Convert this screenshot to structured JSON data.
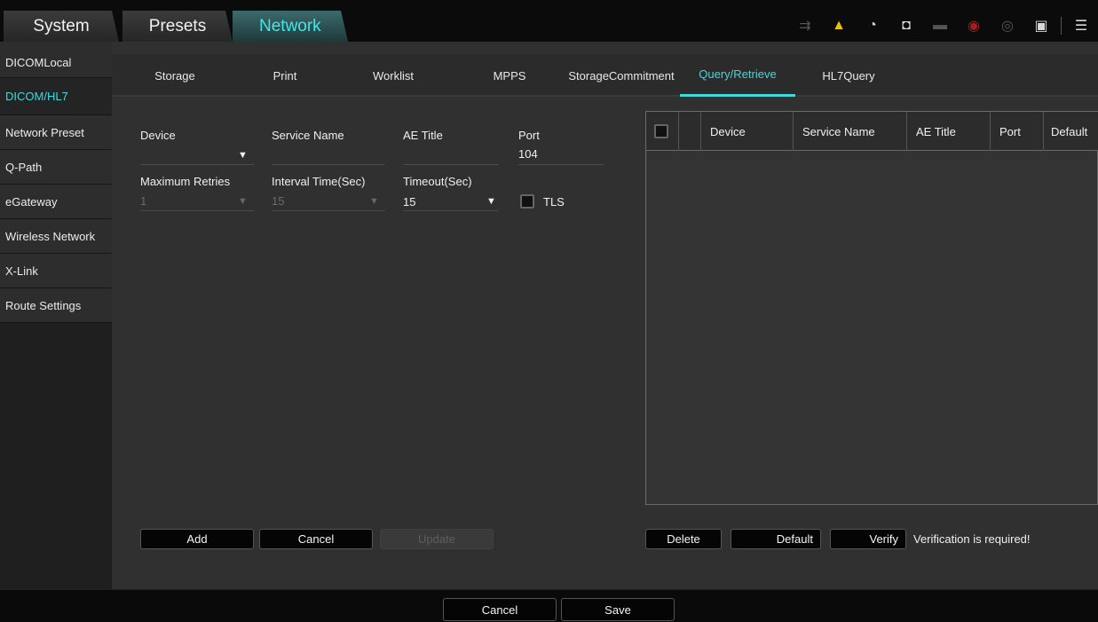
{
  "top_tabs": [
    {
      "label": "System"
    },
    {
      "label": "Presets"
    },
    {
      "label": "Network"
    }
  ],
  "top_icons": [
    "ime-icon",
    "warning-icon",
    "refresh-icon",
    "mouse-icon",
    "usb-icon",
    "network-icon",
    "disc-icon",
    "printer-icon",
    "menu-icon"
  ],
  "sidebar": {
    "items": [
      {
        "label": "DICOMLocal"
      },
      {
        "label": "DICOM/HL7"
      },
      {
        "label": "Network Preset"
      },
      {
        "label": "Q-Path"
      },
      {
        "label": "eGateway"
      },
      {
        "label": "Wireless Network"
      },
      {
        "label": "X-Link"
      },
      {
        "label": "Route Settings"
      }
    ],
    "active": "DICOM/HL7"
  },
  "sub_tabs": [
    {
      "label": "Storage"
    },
    {
      "label": "Print"
    },
    {
      "label": "Worklist"
    },
    {
      "label": "MPPS"
    },
    {
      "label": "StorageCommitment"
    },
    {
      "label": "Query/Retrieve"
    },
    {
      "label": "HL7Query"
    }
  ],
  "active_sub_tab": "Query/Retrieve",
  "form": {
    "device_label": "Device",
    "device_value": "",
    "service_name_label": "Service Name",
    "service_name_value": "",
    "ae_title_label": "AE Title",
    "ae_title_value": "",
    "port_label": "Port",
    "port_value": "104",
    "max_retries_label": "Maximum Retries",
    "max_retries_value": "1",
    "interval_label": "Interval Time(Sec)",
    "interval_value": "15",
    "timeout_label": "Timeout(Sec)",
    "timeout_value": "15",
    "tls_label": "TLS",
    "tls_checked": false
  },
  "table": {
    "headers": [
      "Device",
      "Service Name",
      "AE Title",
      "Port",
      "Default"
    ],
    "rows": []
  },
  "buttons": {
    "add": "Add",
    "cancel": "Cancel",
    "update": "Update",
    "delete": "Delete",
    "default": "Default",
    "verify": "Verify"
  },
  "verification_message": "Verification is required!",
  "bottom": {
    "cancel": "Cancel",
    "save": "Save"
  },
  "colors": {
    "accent": "#3fd8dc",
    "background": "#303030",
    "warning": "#e6c200"
  }
}
